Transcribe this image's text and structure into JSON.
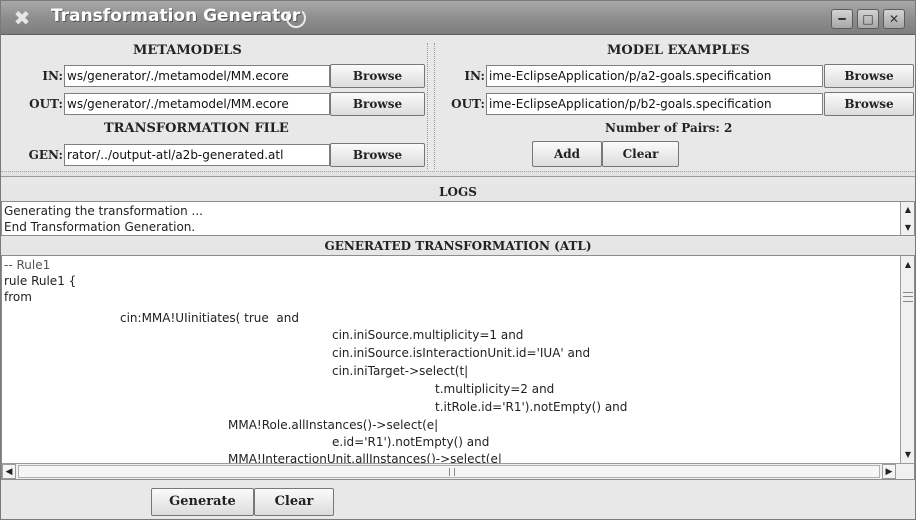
{
  "window": {
    "title": "Transformation Generator",
    "controls": [
      "minimize-icon",
      "maximize-icon",
      "close-icon"
    ]
  },
  "metamodels": {
    "heading": "METAMODELS",
    "in_label": "IN:",
    "in_value": "ws/generator/./metamodel/MM.ecore",
    "out_label": "OUT:",
    "out_value": "ws/generator/./metamodel/MM.ecore",
    "browse_label": "Browse"
  },
  "transformation_file": {
    "heading": "TRANSFORMATION FILE",
    "gen_label": "GEN:",
    "gen_value": "rator/../output-atl/a2b-generated.atl",
    "browse_label": "Browse"
  },
  "model_examples": {
    "heading": "MODEL EXAMPLES",
    "in_label": "IN:",
    "in_value": "ime-EclipseApplication/p/a2-goals.specification",
    "out_label": "OUT:",
    "out_value": "ime-EclipseApplication/p/b2-goals.specification",
    "browse_label": "Browse",
    "pairs_text": "Number of Pairs: 2",
    "add_label": "Add",
    "clear_label": "Clear"
  },
  "logs": {
    "heading": "LOGS",
    "lines": [
      "Generating the transformation ...",
      "End Transformation Generation."
    ]
  },
  "generated": {
    "heading": "GENERATED TRANSFORMATION (ATL)",
    "lines": [
      "-- Rule1",
      "rule Rule1 {",
      "from",
      "cin:MMA!UIinitiates( true  and",
      "cin.iniSource.multiplicity=1 and",
      "cin.iniSource.isInteractionUnit.id='IUA' and",
      "cin.iniTarget->select(t|",
      "t.multiplicity=2 and",
      "t.itRole.id='R1').notEmpty() and",
      "MMA!Role.allInstances()->select(e|",
      "e.id='R1').notEmpty() and",
      "MMA!InteractionUnit.allInstances()->select(e|"
    ]
  },
  "actions": {
    "generate_label": "Generate",
    "clear_label": "Clear"
  }
}
